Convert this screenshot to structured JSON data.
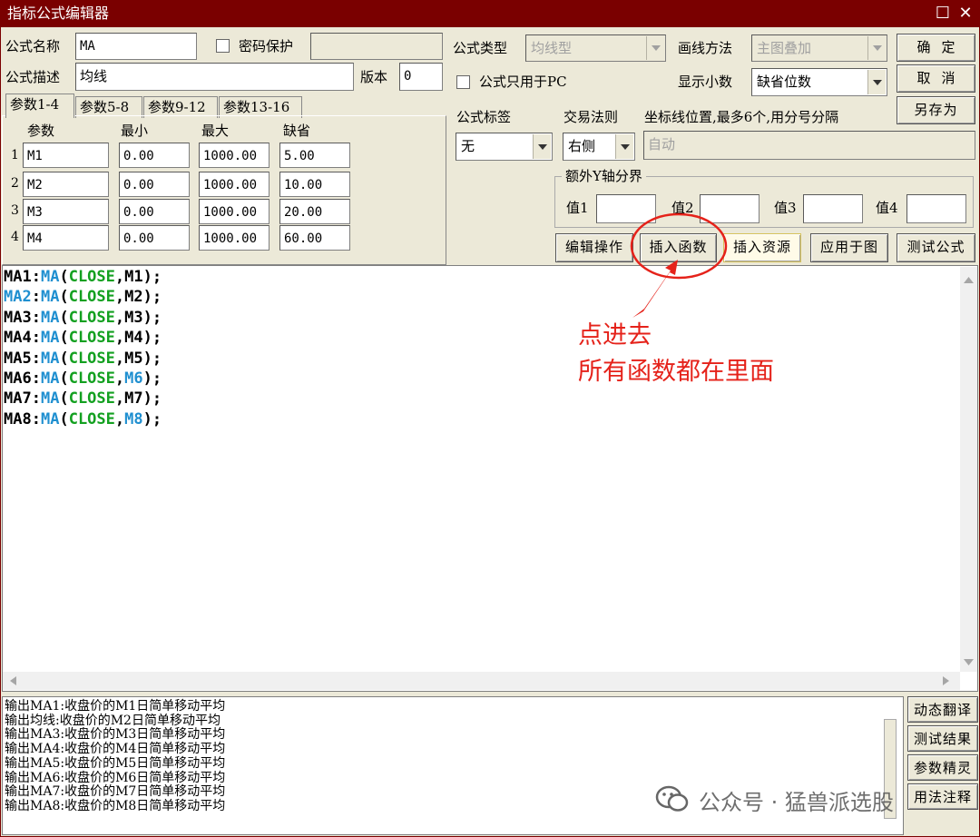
{
  "window": {
    "title": "指标公式编辑器",
    "restore_glyph": "☐",
    "close_glyph": "✕"
  },
  "header": {
    "name_label": "公式名称",
    "name_value": "MA",
    "password_label": "密码保护",
    "password_value": "",
    "desc_label": "公式描述",
    "desc_value": "均线",
    "version_label": "版本",
    "version_value": "0",
    "type_label": "公式类型",
    "type_value": "均线型",
    "draw_label": "画线方法",
    "draw_value": "主图叠加",
    "pc_only_label": "公式只用于PC",
    "decimals_label": "显示小数",
    "decimals_value": "缺省位数",
    "tag_label": "公式标签",
    "tag_value": "无",
    "trade_label": "交易法则",
    "trade_value": "右侧",
    "coord_label": "坐标线位置,最多6个,用分号分隔",
    "coord_value": "自动",
    "yaxis_group_label": "额外Y轴分界",
    "yaxis_values": [
      "值1",
      "值2",
      "值3",
      "值4"
    ]
  },
  "buttons": {
    "ok": "确定",
    "cancel": "取消",
    "save_as": "另存为",
    "edit_ops": "编辑操作",
    "insert_func": "插入函数",
    "insert_res": "插入资源",
    "apply_chart": "应用于图",
    "test_formula": "测试公式",
    "dynamic_translate": "动态翻译",
    "test_result": "测试结果",
    "param_wizard": "参数精灵",
    "usage_note": "用法注释"
  },
  "param_tabs": [
    "参数1-4",
    "参数5-8",
    "参数9-12",
    "参数13-16"
  ],
  "params": {
    "headers": [
      "参数",
      "最小",
      "最大",
      "缺省"
    ],
    "rows": [
      {
        "idx": "1",
        "name": "M1",
        "min": "0.00",
        "max": "1000.00",
        "def": "5.00"
      },
      {
        "idx": "2",
        "name": "M2",
        "min": "0.00",
        "max": "1000.00",
        "def": "10.00"
      },
      {
        "idx": "3",
        "name": "M3",
        "min": "0.00",
        "max": "1000.00",
        "def": "20.00"
      },
      {
        "idx": "4",
        "name": "M4",
        "min": "0.00",
        "max": "1000.00",
        "def": "60.00"
      }
    ]
  },
  "code_lines": [
    [
      [
        "MA1",
        "black"
      ],
      [
        ":",
        "black"
      ],
      [
        "MA",
        "blue"
      ],
      [
        "(",
        "black"
      ],
      [
        "CLOSE",
        "green"
      ],
      [
        ",M1);",
        "black"
      ]
    ],
    [
      [
        "MA2",
        "blue"
      ],
      [
        ":",
        "black"
      ],
      [
        "MA",
        "blue"
      ],
      [
        "(",
        "black"
      ],
      [
        "CLOSE",
        "green"
      ],
      [
        ",M2);",
        "black"
      ]
    ],
    [
      [
        "MA3",
        "black"
      ],
      [
        ":",
        "black"
      ],
      [
        "MA",
        "blue"
      ],
      [
        "(",
        "black"
      ],
      [
        "CLOSE",
        "green"
      ],
      [
        ",M3);",
        "black"
      ]
    ],
    [
      [
        "MA4",
        "black"
      ],
      [
        ":",
        "black"
      ],
      [
        "MA",
        "blue"
      ],
      [
        "(",
        "black"
      ],
      [
        "CLOSE",
        "green"
      ],
      [
        ",M4);",
        "black"
      ]
    ],
    [
      [
        "MA5",
        "black"
      ],
      [
        ":",
        "black"
      ],
      [
        "MA",
        "blue"
      ],
      [
        "(",
        "black"
      ],
      [
        "CLOSE",
        "green"
      ],
      [
        ",M5);",
        "black"
      ]
    ],
    [
      [
        "MA6",
        "black"
      ],
      [
        ":",
        "black"
      ],
      [
        "MA",
        "blue"
      ],
      [
        "(",
        "black"
      ],
      [
        "CLOSE",
        "green"
      ],
      [
        ",",
        "black"
      ],
      [
        "M6",
        "blue"
      ],
      [
        ");",
        "black"
      ]
    ],
    [
      [
        "MA7",
        "black"
      ],
      [
        ":",
        "black"
      ],
      [
        "MA",
        "blue"
      ],
      [
        "(",
        "black"
      ],
      [
        "CLOSE",
        "green"
      ],
      [
        ",M7);",
        "black"
      ]
    ],
    [
      [
        "MA8",
        "black"
      ],
      [
        ":",
        "black"
      ],
      [
        "MA",
        "blue"
      ],
      [
        "(",
        "black"
      ],
      [
        "CLOSE",
        "green"
      ],
      [
        ",",
        "black"
      ],
      [
        "M8",
        "blue"
      ],
      [
        ");",
        "black"
      ]
    ]
  ],
  "output_lines": [
    "输出MA1:收盘价的M1日简单移动平均",
    "输出均线:收盘价的M2日简单移动平均",
    "输出MA3:收盘价的M3日简单移动平均",
    "输出MA4:收盘价的M4日简单移动平均",
    "输出MA5:收盘价的M5日简单移动平均",
    "输出MA6:收盘价的M6日简单移动平均",
    "输出MA7:收盘价的M7日简单移动平均",
    "输出MA8:收盘价的M8日简单移动平均"
  ],
  "annotation": {
    "line1": "点进去",
    "line2": "所有函数都在里面",
    "color": "#e5221a"
  },
  "watermark": {
    "text": "公众号 · 猛兽派选股"
  },
  "colors": {
    "title_bar": "#7a0000",
    "keyword_blue": "#1f8fd0",
    "keyword_green": "#13a020"
  }
}
